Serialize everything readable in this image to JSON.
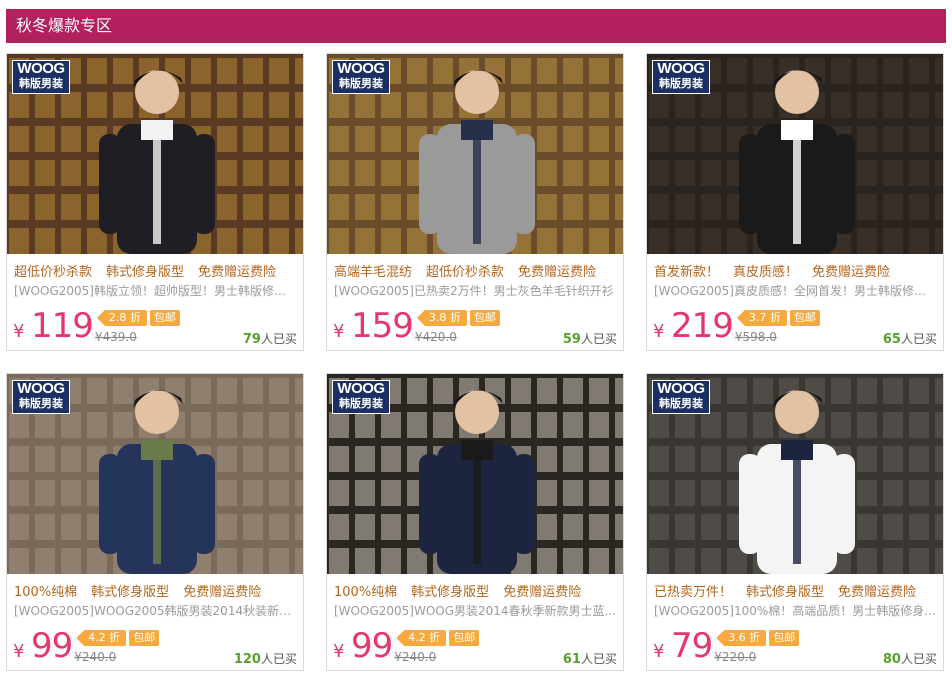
{
  "section_title": "秋冬爆款专区",
  "brand": {
    "line1": "WOOG",
    "line2": "韩版男装"
  },
  "colors": {
    "header": "#b2205e",
    "price": "#e8356c",
    "tag": "#f6a93f",
    "sold_count": "#5aa02c"
  },
  "products": [
    {
      "features": [
        "超低价秒杀款",
        "韩式修身版型",
        "免费赠运费险"
      ],
      "desc": "[WOOG2005]韩版立领！超帅版型！男士韩版修身...",
      "price": "119",
      "discount": "2.8 折",
      "free_ship": "包邮",
      "original": "¥439.0",
      "sold_count": "79",
      "sold_suffix": "人已买"
    },
    {
      "features": [
        "高端羊毛混纺",
        "超低价秒杀款",
        "免费赠运费险"
      ],
      "desc": "[WOOG2005]已热卖2万件！男士灰色羊毛针织开衫",
      "price": "159",
      "discount": "3.8 折",
      "free_ship": "包邮",
      "original": "¥420.0",
      "sold_count": "59",
      "sold_suffix": "人已买"
    },
    {
      "features": [
        "首发新款！",
        "真皮质感！",
        "免费赠运费险"
      ],
      "desc": "[WOOG2005]真皮质感！全网首发！男士韩版修身...",
      "price": "219",
      "discount": "3.7 折",
      "free_ship": "包邮",
      "original": "¥598.0",
      "sold_count": "65",
      "sold_suffix": "人已买"
    },
    {
      "features": [
        "100%纯棉",
        "韩式修身版型",
        "免费赠运费险"
      ],
      "desc": "[WOOG2005]WOOG2005韩版男装2014秋装新款...",
      "price": "99",
      "discount": "4.2 折",
      "free_ship": "包邮",
      "original": "¥240.0",
      "sold_count": "120",
      "sold_suffix": "人已买"
    },
    {
      "features": [
        "100%纯棉",
        "韩式修身版型",
        "免费赠运费险"
      ],
      "desc": "[WOOG2005]WOOG男装2014春秋季新款男士蓝...",
      "price": "99",
      "discount": "4.2 折",
      "free_ship": "包邮",
      "original": "¥240.0",
      "sold_count": "61",
      "sold_suffix": "人已买"
    },
    {
      "features": [
        "已热卖万件！",
        "韩式修身版型",
        "免费赠运费险"
      ],
      "desc": "[WOOG2005]100%棉！高端品质！男士韩版修身...",
      "price": "79",
      "discount": "3.6 折",
      "free_ship": "包邮",
      "original": "¥220.0",
      "sold_count": "80",
      "sold_suffix": "人已买"
    }
  ]
}
